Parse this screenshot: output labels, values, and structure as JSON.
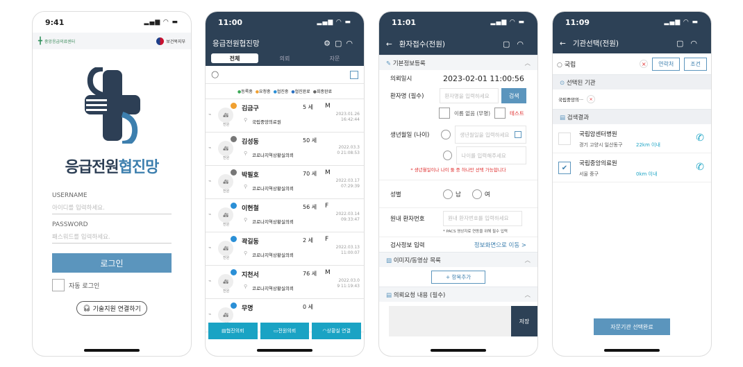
{
  "p1": {
    "time": "9:41",
    "logo_left": "중앙응급의료센터",
    "logo_right": "보건복지부",
    "app_title_a": "응급전원",
    "app_title_b": "협진망",
    "username_label": "USERNAME",
    "username_placeholder": "아이디를 입력하세요.",
    "password_label": "PASSWORD",
    "password_placeholder": "패스워드를 입력하세요.",
    "login": "로그인",
    "auto_login": "자동 로그인",
    "support": "기술지원 연결하기"
  },
  "p2": {
    "time": "11:00",
    "title": "응급전원협진망",
    "tabs": [
      "전체",
      "의뢰",
      "자문"
    ],
    "legend": [
      "등록중",
      "요청중",
      "협진중",
      "협진완료",
      "회종완료"
    ],
    "rows": [
      {
        "name": "김금구",
        "age": "5 세",
        "sex": "M",
        "hosp": "국립중앙의료원",
        "date": "2023.01.26",
        "time": "16:42:44",
        "badge": "전원"
      },
      {
        "name": "김성동",
        "age": "50 세",
        "sex": "",
        "hosp": "코로나지역상황실의뢰",
        "date": "2022.03.3",
        "time": "0 21:08:53",
        "badge": "전원"
      },
      {
        "name": "박필호",
        "age": "70 세",
        "sex": "M",
        "hosp": "코로나지역상황실의뢰",
        "date": "2022.03.17",
        "time": "07:29:39",
        "badge": "전원"
      },
      {
        "name": "이현철",
        "age": "56 세",
        "sex": "F",
        "hosp": "코로나지역상황실의뢰",
        "date": "2022.03.14",
        "time": "09:33:47",
        "badge": "전원"
      },
      {
        "name": "곽길동",
        "age": "2 세",
        "sex": "F",
        "hosp": "코로나지역상황실의뢰",
        "date": "2022.03.13",
        "time": "11:00:07",
        "badge": "전원"
      },
      {
        "name": "지천서",
        "age": "76 세",
        "sex": "M",
        "hosp": "코로나지역상황실의뢰",
        "date": "2022.03.0",
        "time": "9 11:19:43",
        "badge": "전원"
      },
      {
        "name": "무명",
        "age": "0 세",
        "sex": "",
        "hosp": "",
        "date": "",
        "time": "",
        "badge": "전원"
      }
    ],
    "bottom": [
      "협진의뢰",
      "전원의뢰",
      "상황실 연결"
    ]
  },
  "p3": {
    "time": "11:01",
    "title": "환자접수(전원)",
    "basic": "기본정보등록",
    "req_time_label": "의뢰일시",
    "req_time": "2023-02-01 11:00:56",
    "name_label": "환자명 (필수)",
    "name_ph": "환자명을 입력하세요",
    "search": "검색",
    "no_name": "이름 없음 (무명)",
    "test": "테스트",
    "birth_label": "생년월일 (나이)",
    "birth_ph": "생년월일을 입력하세요",
    "age_ph": "나이를 입력해주세요",
    "birth_note": "* 생년월일이나 나이 둘 중 하나만 선택 가능합니다",
    "sex_label": "성별",
    "male": "남",
    "female": "여",
    "pid_label": "원내 환자번호",
    "pid_ph": "원내 환자번호를 입력하세요",
    "pid_note": "* PACS 영상자료 연동을 위해 필수 입력",
    "exam_label": "검사정보 입력",
    "exam_link": "정보화면으로 이동 >",
    "media": "이미지/동영상 목록",
    "add": "+ 항목추가",
    "req_content": "의뢰요청 내용 (필수)",
    "save": "저장"
  },
  "p4": {
    "time": "11:09",
    "title": "기관선택(전원)",
    "search_value": "국립",
    "contact": "연락처",
    "cond": "조건",
    "selected_title": "선택된 기관",
    "selected_chip": "국립중앙의···",
    "results_title": "검색결과",
    "results": [
      {
        "name": "국립암센터병원",
        "addr": "경기 고양시 일산동구",
        "dist": "22km 이내",
        "checked": false
      },
      {
        "name": "국립중앙의료원",
        "addr": "서울 중구",
        "dist": "0km 이내",
        "checked": true
      }
    ],
    "done": "자문기관 선택완료"
  },
  "colors": {
    "navy": "#2d4156",
    "accent": "#5b95bd",
    "brand": "#3d7fae",
    "teal": "#1aa3c4",
    "red": "#e03030"
  }
}
